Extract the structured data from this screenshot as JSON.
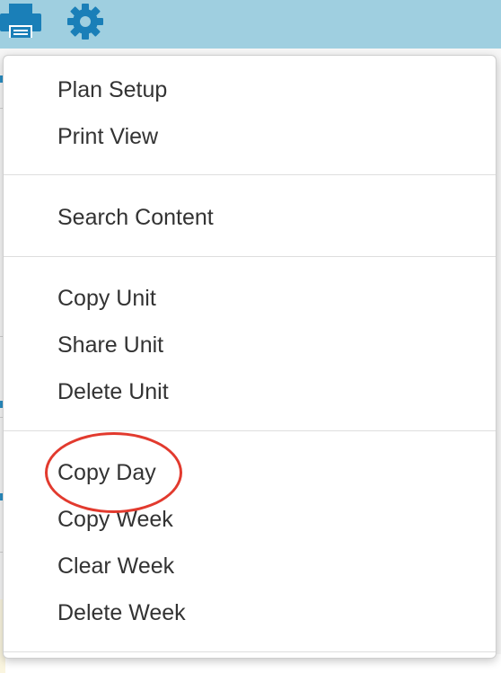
{
  "toolbar": {
    "icons": [
      "print-icon",
      "gear-icon"
    ],
    "background_color": "#9fcfe0",
    "icon_color": "#1a7fb8"
  },
  "menu": {
    "groups": [
      {
        "items": [
          {
            "label": "Plan Setup"
          },
          {
            "label": "Print View"
          }
        ]
      },
      {
        "items": [
          {
            "label": "Search Content"
          }
        ]
      },
      {
        "items": [
          {
            "label": "Copy Unit"
          },
          {
            "label": "Share Unit"
          },
          {
            "label": "Delete Unit"
          }
        ]
      },
      {
        "items": [
          {
            "label": "Copy Day",
            "highlighted": true
          },
          {
            "label": "Copy Week"
          },
          {
            "label": "Clear Week"
          },
          {
            "label": "Delete Week"
          }
        ]
      }
    ]
  },
  "annotation": {
    "highlight_color": "#e23a2e",
    "target": "Copy Day"
  }
}
